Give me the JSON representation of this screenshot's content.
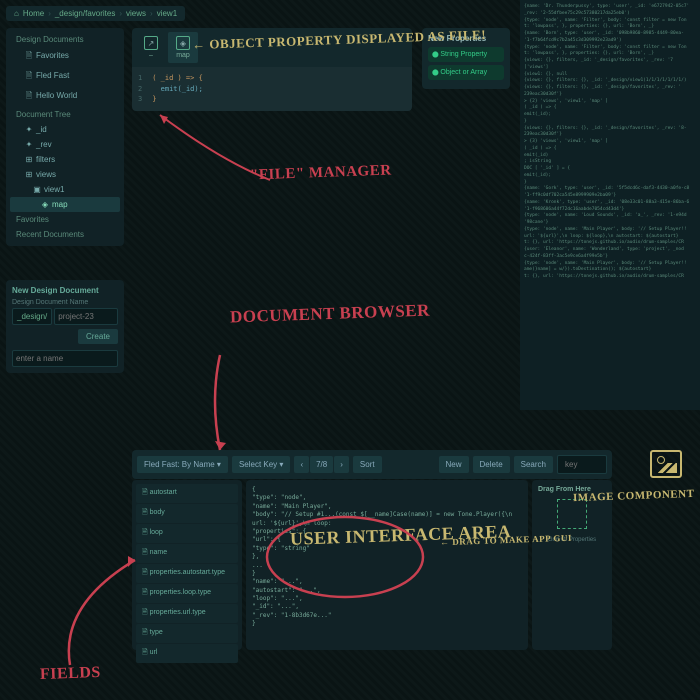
{
  "breadcrumb": [
    "Home",
    "_design/favorites",
    "views",
    "view1"
  ],
  "sidebar": {
    "design_docs_header": "Design Documents",
    "docs": [
      "Favorites",
      "Fled Fast",
      "Hello World"
    ],
    "tree_header": "Document Tree",
    "tree": [
      {
        "icon": "✦",
        "label": "_id"
      },
      {
        "icon": "✦",
        "label": "_rev"
      },
      {
        "icon": "⊞",
        "label": "filters"
      },
      {
        "icon": "⊞",
        "label": "views"
      },
      {
        "icon": "▣",
        "label": "view1",
        "sub": true
      },
      {
        "icon": "◈",
        "label": "map",
        "sub2": true,
        "active": true
      }
    ],
    "fav_header": "Favorites",
    "recent_header": "Recent Documents"
  },
  "newdoc": {
    "title": "New Design Document",
    "label": "Design Document Name",
    "prefix": "_design/",
    "placeholder": "project-23",
    "create": "Create",
    "enter": "enter a name"
  },
  "filemgr": {
    "tab1": "–",
    "tab2": "map",
    "code_l1": "( _id ) => {",
    "code_l2": "emit(_id);",
    "code_l3": "}"
  },
  "newprops": {
    "title": "New Properties",
    "btn1": "String Property",
    "btn2": "Object or Array"
  },
  "toolbar": {
    "title": "Fled Fast: By Name",
    "select_key": "Select Key",
    "page": "7/8",
    "sort": "Sort",
    "new": "New",
    "delete": "Delete",
    "search": "Search",
    "search_ph": "key"
  },
  "fields": [
    "autostart",
    "body",
    "loop",
    "name",
    "properties.autostart.type",
    "properties.loop.type",
    "properties.url.type",
    "type",
    "url"
  ],
  "json_preview": {
    "l1": "{",
    "l2": "  \"type\": \"node\",",
    "l3": "  \"name\": \"Main Player\",",
    "l4": "  \"body\": \"// Setup #1...(const $[__name]Case(name)] = new Tone.Player({\\n url: '${url}',\\n loop:",
    "l5": "  \"properties\": {",
    "l6": "    \"url\": {",
    "l7": "      \"type\": \"string\"",
    "l8": "    },",
    "l9": "    ...",
    "l10": "  }",
    "l11": "  \"name\": \"...\",",
    "l12": "  \"autostart\": \"...\",",
    "l13": "  \"loop\": \"...\",",
    "l14": "  \"_id\": \"...\",",
    "l15": "  \"_rev\": \"1-8b3d67e...\"",
    "l16": "}"
  },
  "drag": {
    "title": "Drag From Here",
    "caption": "Grid Of Properties"
  },
  "annotations": {
    "obj_prop": "OBJECT PROPERTY DISPLAYED AS FILE!",
    "file_mgr": "\"FILE\" MANAGER",
    "doc_browser": "DOCUMENT BROWSER",
    "ui_area": "USER INTERFACE AREA",
    "fields": "FIELDS",
    "img_comp": "IMAGE COMPONENT",
    "drag_make": "DRAG TO MAKE APP GUI"
  },
  "codebg_lines": [
    "{name: 'Dr. Thunderpussy', type: 'user', _id: 'e6727942-05c7'",
    " _rev: '2-55dfbee75c29c57380217da25eb0')",
    "",
    "{type: 'node', name: 'Filter', body: 'const filter = new Ton",
    " t: 'lowpass', }, properties: {}, url: 'Born', _}",
    "",
    "{name: 'Born', type: 'user', _id: '098b9860-8985-4449-80ea-",
    " '1-f7b64fcd9c7b2a45c3d309992e23ad9')",
    "",
    "{type: 'node', name: 'Filter', body: 'const filter = new Ton",
    " t: 'lowpass', }, properties: {}, url: 'Born', _}",
    "",
    "{views: {}, filters, _id: '_design/favorites', _rev: '7",
    " ['views']",
    "",
    "{view1: {}, null",
    "",
    "{views: {}, filters: {}, _id: '_design/view1)1/1/1/1/1/1/1/)",
    "",
    "{views: {}, filters: {}, _id: '_design/favorites', _rev: '",
    "239eac30d30f'}",
    "> {2}  'views', 'view1', 'map' ]",
    "( _id ) => {",
    "        emit(_id);",
    "        }",
    "",
    "{views: {}, filters: {}, _id: '_design/favorites', _rev: '8-",
    "239eac30d30f'}",
    "> {3}  'views', 'view1', 'map' ]",
    "( _id ) => {",
    "        emit(_id)",
    "        ; isString",
    "DOC [ '_id' ] = {",
    "    emit(_id);",
    "}",
    "",
    "{name: 'Gork', type: 'user', _id: '5f5dcd6c-daf3-4430-a0fe-c8",
    " '1-ff9c0df702ca545e8999909e2ba09'}",
    "",
    "{name: 'Kronk', type: 'user', _id: '08e33c01-88a3-415e-86ba-6",
    " '1-f968606a44f72dc16aabde7054cd43d4'}",
    "",
    "{type: 'node', name: 'Loud Sounds', _id: 'a_', _rev: '1-e94d",
    " '98cane'}",
    "",
    "{type: 'node', name: 'Main Player', body: '// Setup Player!!",
    " url: '${url}',\\n loop: ${loop},\\n autostart: ${autostart}",
    " t: {}, url: 'https://tonejs.github.io/audio/drum-samples/CR",
    "",
    "{user: 'Eleanor', name: 'Wonderland', type: 'project', _nod",
    " c-424f-83ff-3ac5e9ce6a4f99e5b'}",
    "",
    "{type: 'node', name: 'Main Player', body: '// Setup Player!!",
    " ame)}name] = w/}).toDestination(); ${autostart}",
    " t: {}, url: 'https://tonejs.github.io/audio/drum-samples/CR"
  ]
}
